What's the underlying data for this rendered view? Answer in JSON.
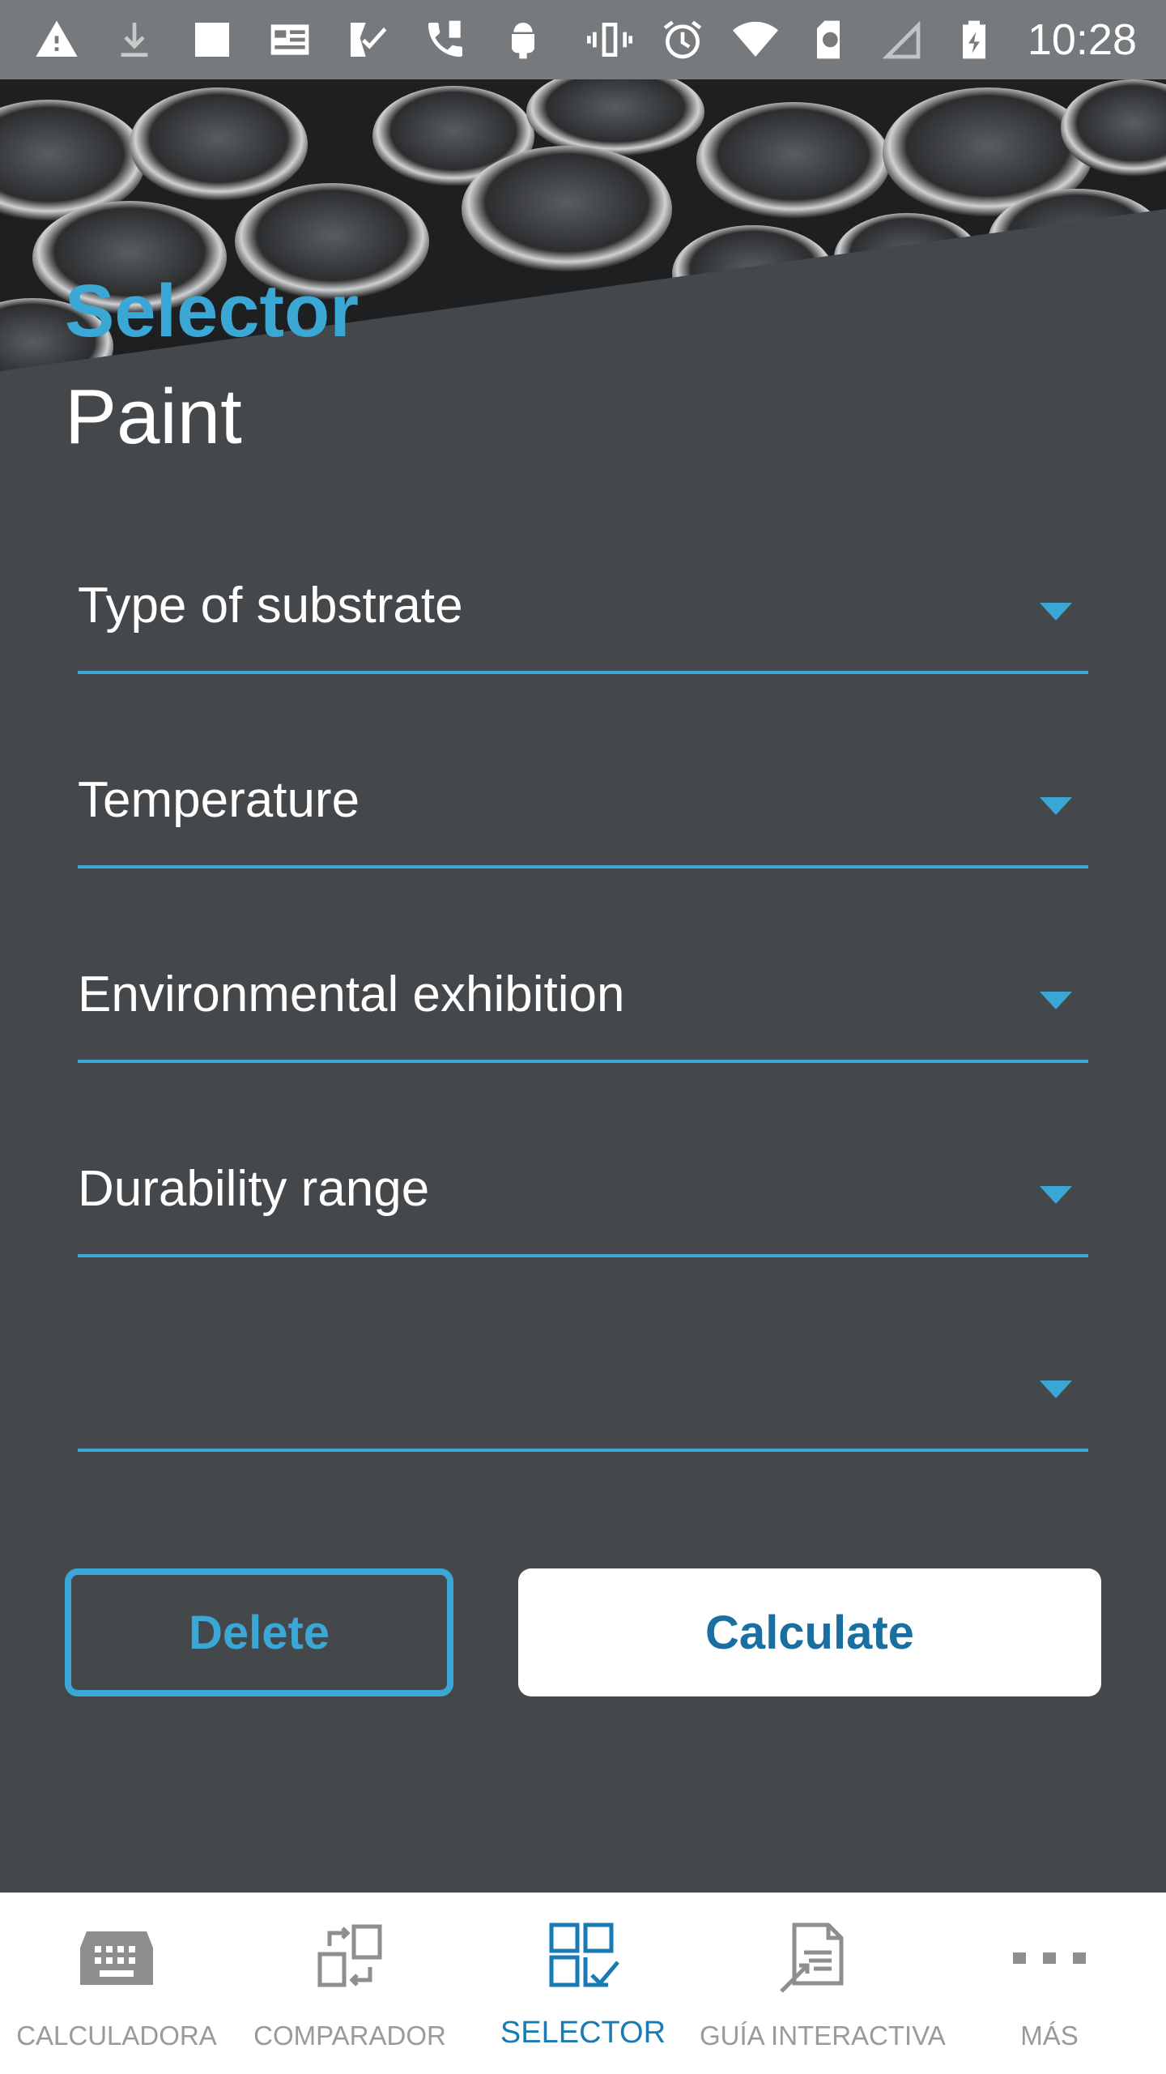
{
  "status_bar": {
    "time": "10:28",
    "icons": [
      "warning-icon",
      "download-icon",
      "square-icon",
      "news-icon",
      "task-icon",
      "phone-alert-icon",
      "android-icon",
      "vibrate-icon",
      "alarm-icon",
      "wifi-icon",
      "sd-card-icon",
      "signal-icon",
      "battery-charging-icon"
    ]
  },
  "header": {
    "accent_title": "Selector",
    "main_title": "Paint"
  },
  "form": {
    "fields": [
      {
        "label": "Type of substrate"
      },
      {
        "label": "Temperature"
      },
      {
        "label": "Environmental exhibition"
      },
      {
        "label": "Durability range"
      },
      {
        "label": ""
      }
    ]
  },
  "actions": {
    "delete_label": "Delete",
    "calculate_label": "Calculate"
  },
  "bottom_nav": {
    "items": [
      {
        "label": "CALCULADORA",
        "icon": "calculator-icon",
        "active": false
      },
      {
        "label": "COMPARADOR",
        "icon": "compare-icon",
        "active": false
      },
      {
        "label": "SELECTOR",
        "icon": "selector-icon",
        "active": true
      },
      {
        "label": "GUÍA INTERACTIVA",
        "icon": "guide-icon",
        "active": false
      },
      {
        "label": "MÁS",
        "icon": "more-icon",
        "active": false
      }
    ]
  },
  "colors": {
    "accent": "#3aa7d4",
    "background": "#44484b",
    "active_nav": "#1a7ab3",
    "inactive_nav": "#9a9a9a"
  }
}
